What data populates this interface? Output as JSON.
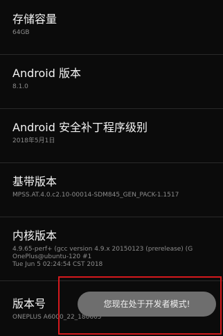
{
  "items": [
    {
      "title": "存储容量",
      "subtitle": [
        "64GB"
      ]
    },
    {
      "title": "Android 版本",
      "subtitle": [
        "8.1.0"
      ]
    },
    {
      "title": "Android 安全补丁程序级别",
      "subtitle": [
        "2018年5月1日"
      ]
    },
    {
      "title": "基带版本",
      "subtitle": [
        "MPSS.AT.4.0.c2.10-00014-SDM845_GEN_PACK-1.1517"
      ]
    },
    {
      "title": "内核版本",
      "subtitle": [
        "4.9.65-perf+ (gcc version 4.9.x 20150123 (prerelease) (G",
        "OnePlus@ubuntu-120 #1",
        "Tue Jun 5 02:24:54 CST 2018"
      ]
    },
    {
      "title": "版本号",
      "subtitle": [
        "ONEPLUS A6000_22_180605"
      ]
    }
  ],
  "toast": {
    "text": "您现在处于开发者模式!"
  }
}
